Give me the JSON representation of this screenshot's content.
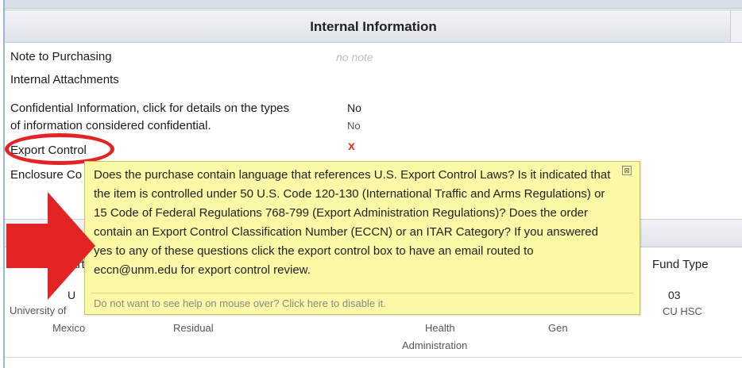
{
  "header": {
    "title": "Internal Information"
  },
  "fields": {
    "note_to_purchasing_label": "Note to Purchasing",
    "note_to_purchasing_value": "no note",
    "internal_attachments_label": "Internal Attachments",
    "confidential_label_line1": "Confidential Information, click for details on the types",
    "confidential_label_line2": "of information considered confidential.",
    "confidential_value": "No",
    "confidential_value2": "No",
    "export_control_label": "Export Control",
    "export_control_value": "x",
    "enclosure_label": "Enclosure Co"
  },
  "tooltip": {
    "text": "Does the purchase contain language that references U.S. Export Control Laws? Is it indicated that the item is controlled under 50 U.S. Code 120-130 (International Traffic and Arms Regulations) or 15 Code of Federal Regulations 768-799 (Export Administration Regulations)? Does the order contain an Export Control Classification Number (ECCN) or an ITAR Category? If you answered yes to any of these questions click the export control box to have an email routed to eccn@unm.edu for export control review.",
    "footer": "Do not want to see help on mouse over? Click here to disable it.",
    "close": "⊠"
  },
  "table": {
    "headers": {
      "chart": "Chart",
      "fund_type": "Fund Type"
    },
    "chart_code": "U",
    "chart_name_line1": "University of",
    "chart_name_line2": "Mexico",
    "col2": "Residual",
    "col3_line1": "Health",
    "col3_line2": "Administration",
    "col4": "Gen",
    "fund_type_code": "03",
    "fund_type_name": "CU HSC"
  },
  "colors": {
    "annotation_red": "#e22424",
    "tooltip_bg": "#fbf8a6"
  }
}
